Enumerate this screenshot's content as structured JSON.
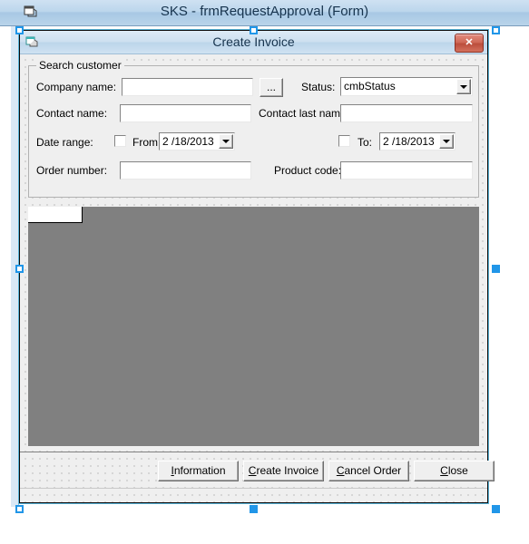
{
  "outer_window": {
    "title": "SKS - frmRequestApproval (Form)",
    "icon": "form-designer-icon"
  },
  "form": {
    "title": "Create Invoice",
    "icon": "form-icon",
    "close_label": "✕"
  },
  "groupbox": {
    "title": "Search customer",
    "fields": {
      "company_name_label": "Company name:",
      "company_name_value": "",
      "browse_button_label": "...",
      "status_label": "Status:",
      "status_value": "cmbStatus",
      "contact_name_label": "Contact name:",
      "contact_name_value": "",
      "contact_last_name_label": "Contact last name:",
      "contact_last_name_value": "",
      "date_range_label": "Date range:",
      "from_label": "From:",
      "from_date": "2 /18/2013",
      "to_label": "To:",
      "to_date": "2 /18/2013",
      "order_number_label": "Order number:",
      "order_number_value": "",
      "product_code_label": "Product code:",
      "product_code_value": ""
    }
  },
  "panel": {
    "tab_label": "",
    "background_color": "#808080"
  },
  "buttons": {
    "information": {
      "pre": "",
      "key": "I",
      "post": "nformation"
    },
    "create_invoice": {
      "pre": "",
      "key": "C",
      "post": "reate Invoice"
    },
    "cancel_order": {
      "pre": "",
      "key": "C",
      "post": "ancel Order"
    },
    "close": {
      "pre": "",
      "key": "C",
      "post": "lose"
    }
  },
  "colors": {
    "titlebar_accent": "#a8c8e4",
    "close_button": "#bb4e3c",
    "selection_handle": "#2196e8",
    "panel_gray": "#808080",
    "form_face": "#efefef"
  }
}
